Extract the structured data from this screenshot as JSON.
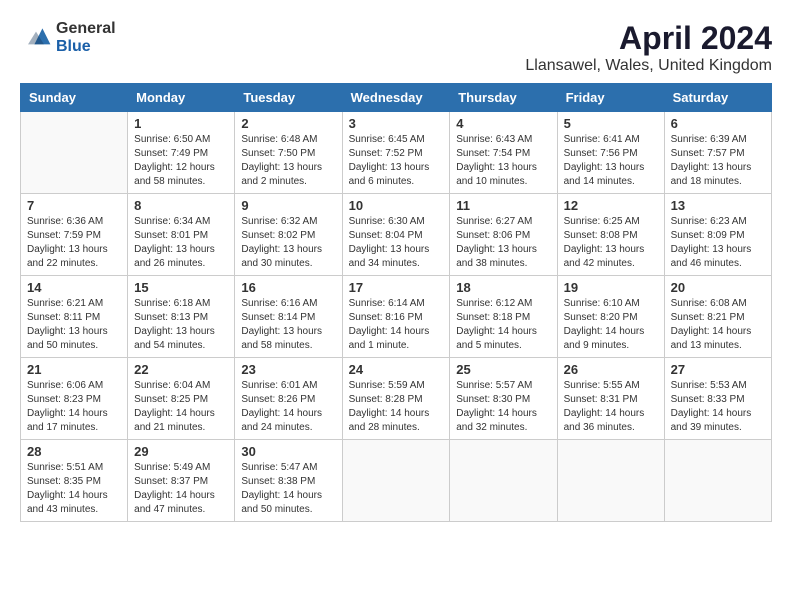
{
  "logo": {
    "general": "General",
    "blue": "Blue"
  },
  "title": "April 2024",
  "subtitle": "Llansawel, Wales, United Kingdom",
  "days_of_week": [
    "Sunday",
    "Monday",
    "Tuesday",
    "Wednesday",
    "Thursday",
    "Friday",
    "Saturday"
  ],
  "weeks": [
    [
      {
        "day": "",
        "info": ""
      },
      {
        "day": "1",
        "info": "Sunrise: 6:50 AM\nSunset: 7:49 PM\nDaylight: 12 hours\nand 58 minutes."
      },
      {
        "day": "2",
        "info": "Sunrise: 6:48 AM\nSunset: 7:50 PM\nDaylight: 13 hours\nand 2 minutes."
      },
      {
        "day": "3",
        "info": "Sunrise: 6:45 AM\nSunset: 7:52 PM\nDaylight: 13 hours\nand 6 minutes."
      },
      {
        "day": "4",
        "info": "Sunrise: 6:43 AM\nSunset: 7:54 PM\nDaylight: 13 hours\nand 10 minutes."
      },
      {
        "day": "5",
        "info": "Sunrise: 6:41 AM\nSunset: 7:56 PM\nDaylight: 13 hours\nand 14 minutes."
      },
      {
        "day": "6",
        "info": "Sunrise: 6:39 AM\nSunset: 7:57 PM\nDaylight: 13 hours\nand 18 minutes."
      }
    ],
    [
      {
        "day": "7",
        "info": "Sunrise: 6:36 AM\nSunset: 7:59 PM\nDaylight: 13 hours\nand 22 minutes."
      },
      {
        "day": "8",
        "info": "Sunrise: 6:34 AM\nSunset: 8:01 PM\nDaylight: 13 hours\nand 26 minutes."
      },
      {
        "day": "9",
        "info": "Sunrise: 6:32 AM\nSunset: 8:02 PM\nDaylight: 13 hours\nand 30 minutes."
      },
      {
        "day": "10",
        "info": "Sunrise: 6:30 AM\nSunset: 8:04 PM\nDaylight: 13 hours\nand 34 minutes."
      },
      {
        "day": "11",
        "info": "Sunrise: 6:27 AM\nSunset: 8:06 PM\nDaylight: 13 hours\nand 38 minutes."
      },
      {
        "day": "12",
        "info": "Sunrise: 6:25 AM\nSunset: 8:08 PM\nDaylight: 13 hours\nand 42 minutes."
      },
      {
        "day": "13",
        "info": "Sunrise: 6:23 AM\nSunset: 8:09 PM\nDaylight: 13 hours\nand 46 minutes."
      }
    ],
    [
      {
        "day": "14",
        "info": "Sunrise: 6:21 AM\nSunset: 8:11 PM\nDaylight: 13 hours\nand 50 minutes."
      },
      {
        "day": "15",
        "info": "Sunrise: 6:18 AM\nSunset: 8:13 PM\nDaylight: 13 hours\nand 54 minutes."
      },
      {
        "day": "16",
        "info": "Sunrise: 6:16 AM\nSunset: 8:14 PM\nDaylight: 13 hours\nand 58 minutes."
      },
      {
        "day": "17",
        "info": "Sunrise: 6:14 AM\nSunset: 8:16 PM\nDaylight: 14 hours\nand 1 minute."
      },
      {
        "day": "18",
        "info": "Sunrise: 6:12 AM\nSunset: 8:18 PM\nDaylight: 14 hours\nand 5 minutes."
      },
      {
        "day": "19",
        "info": "Sunrise: 6:10 AM\nSunset: 8:20 PM\nDaylight: 14 hours\nand 9 minutes."
      },
      {
        "day": "20",
        "info": "Sunrise: 6:08 AM\nSunset: 8:21 PM\nDaylight: 14 hours\nand 13 minutes."
      }
    ],
    [
      {
        "day": "21",
        "info": "Sunrise: 6:06 AM\nSunset: 8:23 PM\nDaylight: 14 hours\nand 17 minutes."
      },
      {
        "day": "22",
        "info": "Sunrise: 6:04 AM\nSunset: 8:25 PM\nDaylight: 14 hours\nand 21 minutes."
      },
      {
        "day": "23",
        "info": "Sunrise: 6:01 AM\nSunset: 8:26 PM\nDaylight: 14 hours\nand 24 minutes."
      },
      {
        "day": "24",
        "info": "Sunrise: 5:59 AM\nSunset: 8:28 PM\nDaylight: 14 hours\nand 28 minutes."
      },
      {
        "day": "25",
        "info": "Sunrise: 5:57 AM\nSunset: 8:30 PM\nDaylight: 14 hours\nand 32 minutes."
      },
      {
        "day": "26",
        "info": "Sunrise: 5:55 AM\nSunset: 8:31 PM\nDaylight: 14 hours\nand 36 minutes."
      },
      {
        "day": "27",
        "info": "Sunrise: 5:53 AM\nSunset: 8:33 PM\nDaylight: 14 hours\nand 39 minutes."
      }
    ],
    [
      {
        "day": "28",
        "info": "Sunrise: 5:51 AM\nSunset: 8:35 PM\nDaylight: 14 hours\nand 43 minutes."
      },
      {
        "day": "29",
        "info": "Sunrise: 5:49 AM\nSunset: 8:37 PM\nDaylight: 14 hours\nand 47 minutes."
      },
      {
        "day": "30",
        "info": "Sunrise: 5:47 AM\nSunset: 8:38 PM\nDaylight: 14 hours\nand 50 minutes."
      },
      {
        "day": "",
        "info": ""
      },
      {
        "day": "",
        "info": ""
      },
      {
        "day": "",
        "info": ""
      },
      {
        "day": "",
        "info": ""
      }
    ]
  ]
}
